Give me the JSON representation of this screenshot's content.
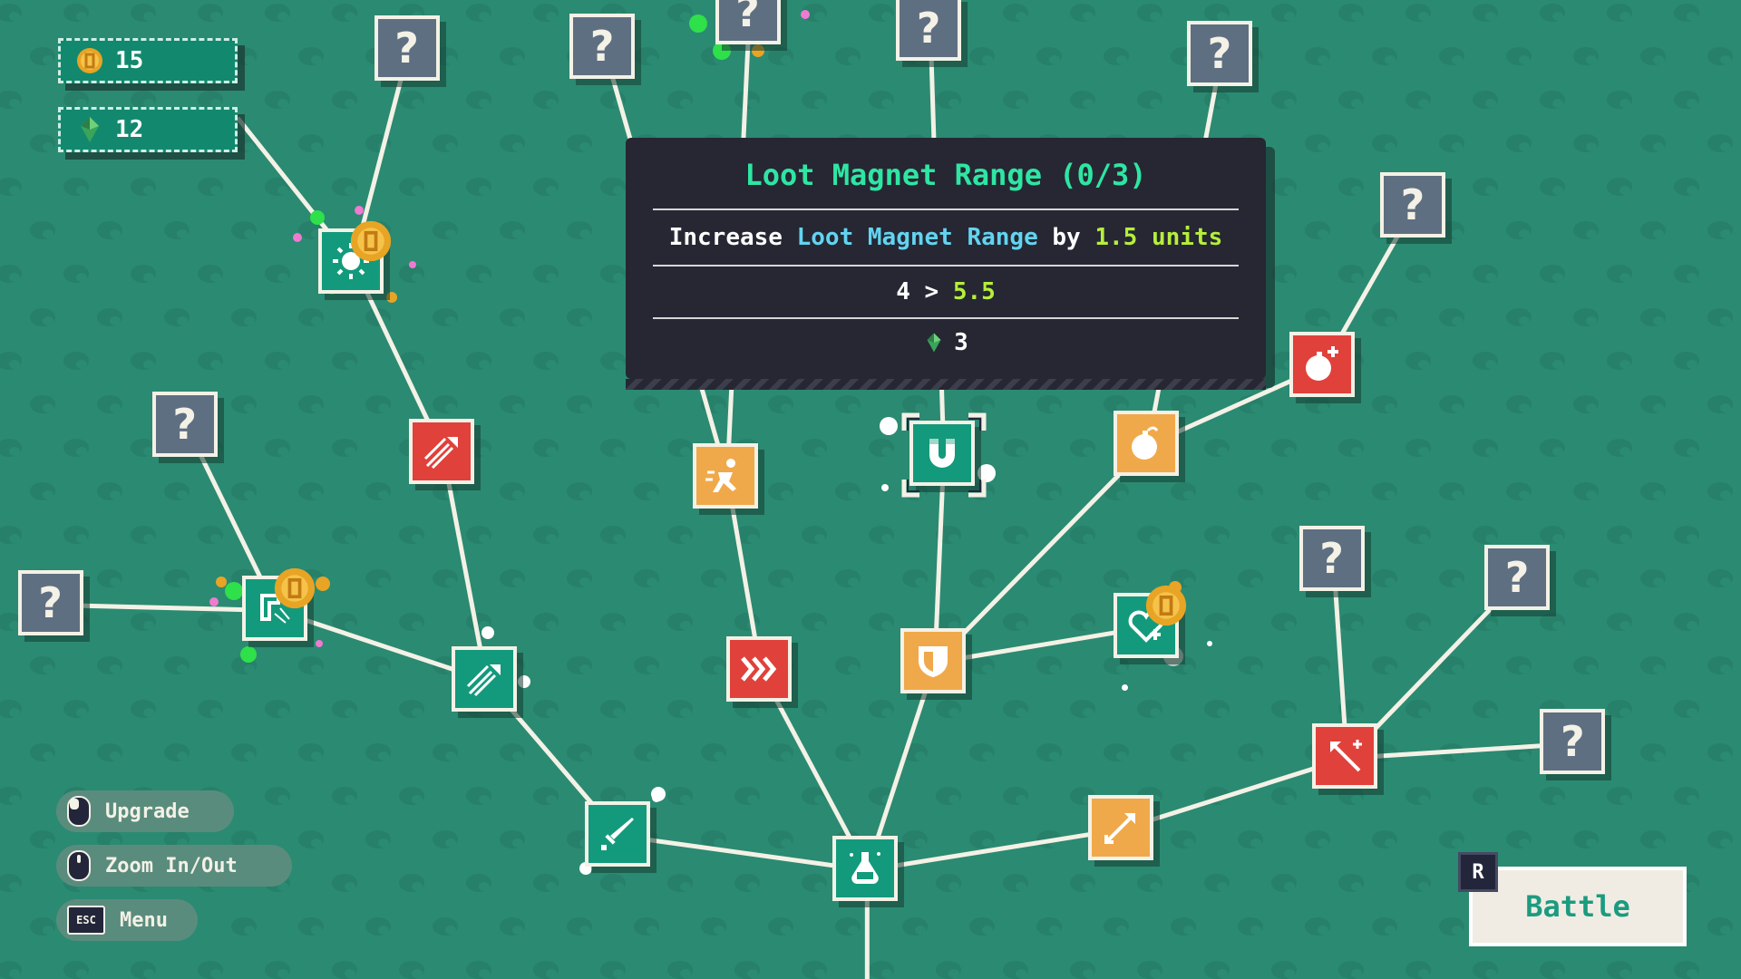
{
  "resources": {
    "coins": "15",
    "gems": "12"
  },
  "tooltip": {
    "title": "Loot Magnet Range (0/3)",
    "desc_prefix": "Increase",
    "desc_kw1": "Loot",
    "desc_kw2": "Magnet",
    "desc_kw3": "Range",
    "desc_by": "by",
    "desc_amount": "1.5",
    "desc_unit": "units",
    "stat_from": "4",
    "stat_arrow": ">",
    "stat_to": "5.5",
    "cost": "3"
  },
  "hints": {
    "upgrade": "Upgrade",
    "zoom": "Zoom In/Out",
    "menu": "Menu",
    "menu_key": "ESC"
  },
  "battle": {
    "label": "Battle",
    "key": "R"
  },
  "colors": {
    "background": "#2b8a72",
    "tree_green": "#139a7c",
    "tree_red": "#e0413b",
    "tree_orange": "#f0a94a",
    "locked": "#5f6f82",
    "tooltip_title": "#2ee6a3",
    "keyword_cyan": "#62d4f0",
    "keyword_lime": "#b6ef3b"
  },
  "skill_tree": {
    "nodes": [
      {
        "id": "root-potion",
        "state": "green",
        "icon": "potion-icon",
        "name": "potion-node"
      },
      {
        "id": "sword",
        "state": "green",
        "icon": "sword-icon",
        "name": "sword-node"
      },
      {
        "id": "multi-arrow-green",
        "state": "green",
        "icon": "multi-arrow-icon",
        "name": "multi-arrow-node"
      },
      {
        "id": "boomerang",
        "state": "green",
        "icon": "boomerang-icon",
        "name": "boomerang-node",
        "coin": true
      },
      {
        "id": "sun",
        "state": "green",
        "icon": "sun-icon",
        "name": "sun-node",
        "coin": true
      },
      {
        "id": "multi-arrow-red",
        "state": "red",
        "icon": "multi-arrow-icon",
        "name": "multi-arrow-red-node"
      },
      {
        "id": "speed",
        "state": "red",
        "icon": "chevrons-icon",
        "name": "speed-node"
      },
      {
        "id": "dash",
        "state": "orange",
        "icon": "running-man-icon",
        "name": "dash-node"
      },
      {
        "id": "shield",
        "state": "orange",
        "icon": "shield-icon",
        "name": "shield-node"
      },
      {
        "id": "magnet",
        "state": "green",
        "icon": "magnet-icon",
        "name": "magnet-node",
        "selected": true
      },
      {
        "id": "bomb-orange",
        "state": "orange",
        "icon": "bomb-icon",
        "name": "bomb-node"
      },
      {
        "id": "bomb-red",
        "state": "red",
        "icon": "bomb-plus-icon",
        "name": "bomb-plus-node"
      },
      {
        "id": "heal",
        "state": "green",
        "icon": "heart-plus-icon",
        "name": "heal-node",
        "coin": true
      },
      {
        "id": "arrow-orange",
        "state": "orange",
        "icon": "arrow-icon",
        "name": "arrow-node"
      },
      {
        "id": "arrow-red",
        "state": "red",
        "icon": "arrow-plus-icon",
        "name": "arrow-plus-node"
      },
      {
        "id": "hidden-boomerang-1",
        "state": "locked",
        "icon": "question-icon",
        "name": "locked-node"
      },
      {
        "id": "hidden-boomerang-2",
        "state": "locked",
        "icon": "question-icon",
        "name": "locked-node"
      },
      {
        "id": "hidden-sun",
        "state": "locked",
        "icon": "question-icon",
        "name": "locked-node"
      },
      {
        "id": "hidden-dash",
        "state": "locked",
        "icon": "question-icon",
        "name": "locked-node"
      },
      {
        "id": "hidden-top-1",
        "state": "locked",
        "icon": "question-icon",
        "name": "locked-node"
      },
      {
        "id": "hidden-top-2",
        "state": "locked",
        "icon": "question-icon",
        "name": "locked-node"
      },
      {
        "id": "hidden-top-3",
        "state": "locked",
        "icon": "question-icon",
        "name": "locked-node"
      },
      {
        "id": "hidden-bomb",
        "state": "locked",
        "icon": "question-icon",
        "name": "locked-node"
      },
      {
        "id": "hidden-arrow-1",
        "state": "locked",
        "icon": "question-icon",
        "name": "locked-node"
      },
      {
        "id": "hidden-arrow-2",
        "state": "locked",
        "icon": "question-icon",
        "name": "locked-node"
      },
      {
        "id": "hidden-arrow-3",
        "state": "locked",
        "icon": "question-icon",
        "name": "locked-node"
      }
    ],
    "locked_label": "?"
  }
}
